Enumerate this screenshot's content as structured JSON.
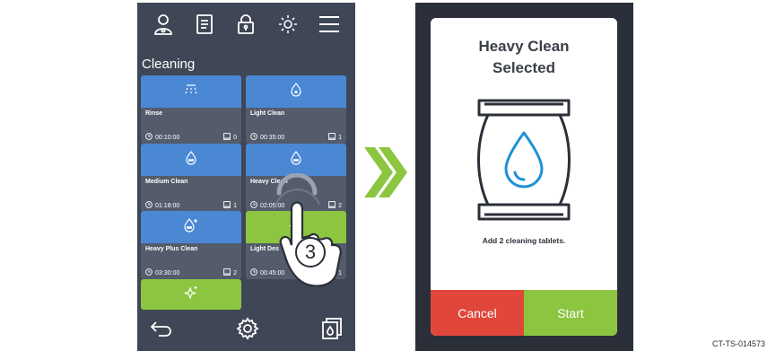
{
  "left_screen": {
    "section_title": "Cleaning",
    "top_icons": [
      "user-icon",
      "document-icon",
      "lock-icon",
      "brightness-icon",
      "menu-icon"
    ],
    "programs": [
      {
        "name": "Rinse",
        "time": "00:10:00",
        "tablets": "0",
        "icon": "spray-icon",
        "color": "#4a88d4"
      },
      {
        "name": "Light Clean",
        "time": "00:35:00",
        "tablets": "1",
        "icon": "drop-icon",
        "color": "#4a88d4"
      },
      {
        "name": "Medium Clean",
        "time": "01:18:00",
        "tablets": "1",
        "icon": "drops-icon",
        "color": "#4a88d4"
      },
      {
        "name": "Heavy Clean",
        "time": "02:05:00",
        "tablets": "2",
        "icon": "drops-icon",
        "color": "#4a88d4"
      },
      {
        "name": "Heavy Plus Clean",
        "time": "03:30:00",
        "tablets": "2",
        "icon": "drops-plus-icon",
        "color": "#4a88d4"
      },
      {
        "name": "Light Des",
        "time": "00:45:00",
        "tablets": "1",
        "icon": "sparkle-icon",
        "color": "#8cc540"
      },
      {
        "icon": "sparkle-icon",
        "color": "#8cc540"
      }
    ],
    "bottom_icons": [
      "back-icon",
      "settings-icon",
      "tablet-box-icon"
    ],
    "step_number": "3"
  },
  "right_screen": {
    "modal": {
      "title_line1": "Heavy Clean",
      "title_line2": "Selected",
      "message": "Add 2 cleaning tablets.",
      "cancel_label": "Cancel",
      "start_label": "Start"
    }
  },
  "reference_code": "CT-TS-014573"
}
